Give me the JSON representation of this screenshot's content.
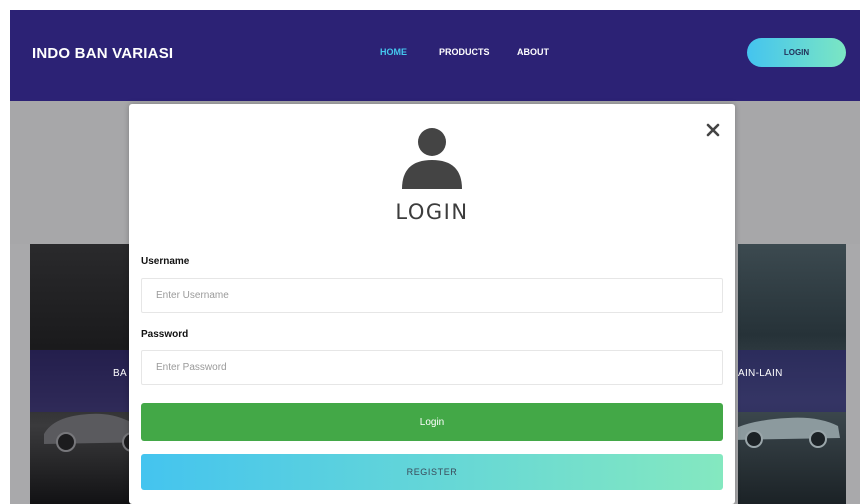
{
  "navbar": {
    "brand": "INDO BAN VARIASI",
    "links": [
      {
        "label": "HOME",
        "active": true
      },
      {
        "label": "PRODUCTS",
        "active": false
      },
      {
        "label": "ABOUT",
        "active": false
      }
    ],
    "login_button": "LOGIN"
  },
  "background_cards": {
    "left_label": "BA",
    "right_label": "AIN-LAIN"
  },
  "modal": {
    "icon": "user-avatar-icon",
    "title": "LOGIN",
    "close_icon": "close-icon",
    "username": {
      "label": "Username",
      "placeholder": "Enter Username",
      "value": ""
    },
    "password": {
      "label": "Password",
      "placeholder": "Enter Password",
      "value": ""
    },
    "login_button": "Login",
    "register_button": "REGISTER"
  },
  "colors": {
    "navbar_bg": "#2c2275",
    "active_link": "#45c8ef",
    "login_green": "#43a847",
    "gradient_start": "#44c4ef",
    "gradient_end": "#7be6c3",
    "overlay": "#a9a9ab"
  }
}
